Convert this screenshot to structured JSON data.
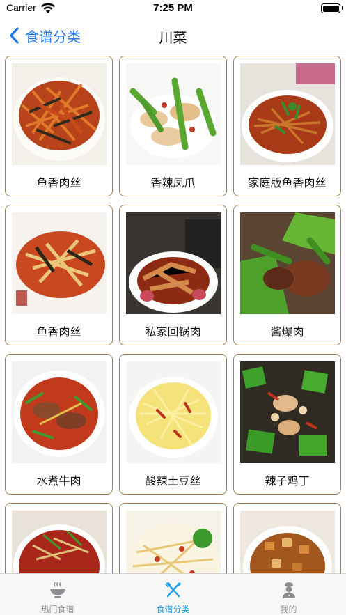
{
  "status_bar": {
    "carrier": "Carrier",
    "time": "7:25 PM"
  },
  "nav": {
    "back_label": "食谱分类",
    "title": "川菜"
  },
  "recipes": [
    {
      "name": "鱼香肉丝"
    },
    {
      "name": "香辣凤爪"
    },
    {
      "name": "家庭版鱼香肉丝"
    },
    {
      "name": "鱼香肉丝"
    },
    {
      "name": "私家回锅肉"
    },
    {
      "name": "酱爆肉"
    },
    {
      "name": "水煮牛肉"
    },
    {
      "name": "酸辣土豆丝"
    },
    {
      "name": "辣子鸡丁"
    },
    {
      "name": ""
    },
    {
      "name": ""
    },
    {
      "name": ""
    }
  ],
  "tabs": [
    {
      "label": "热门食谱",
      "icon": "bowl-icon",
      "active": false
    },
    {
      "label": "食谱分类",
      "icon": "utensils-icon",
      "active": true
    },
    {
      "label": "我的",
      "icon": "chef-icon",
      "active": false
    }
  ],
  "colors": {
    "accent": "#1a73e8",
    "tab_active": "#1a9cf0",
    "tab_inactive": "#8e8e93",
    "card_border": "#a47c52"
  }
}
